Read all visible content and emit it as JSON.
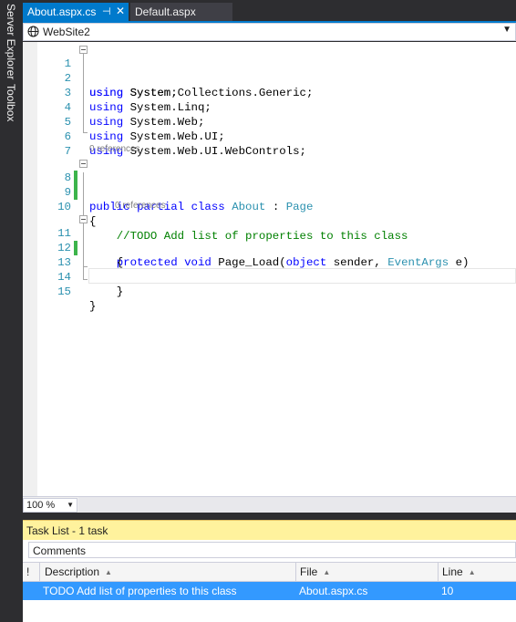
{
  "left_dock": {
    "server_explorer": "Server Explorer",
    "toolbox": "Toolbox"
  },
  "tabs": [
    {
      "label": "About.aspx.cs",
      "active": true,
      "pinned": false
    },
    {
      "label": "Default.aspx",
      "active": false
    }
  ],
  "navbar": {
    "project": "WebSite2"
  },
  "editor": {
    "lines": [
      {
        "number": "1",
        "text": "using System;"
      },
      {
        "number": "2",
        "text": "using System.Collections.Generic;"
      },
      {
        "number": "3",
        "text": "using System.Linq;"
      },
      {
        "number": "4",
        "text": "using System.Web;"
      },
      {
        "number": "5",
        "text": "using System.Web.UI;"
      },
      {
        "number": "6",
        "text": "using System.Web.UI.WebControls;"
      },
      {
        "number": "7",
        "text": ""
      },
      {
        "number": "8",
        "text": "public partial class About : Page"
      },
      {
        "number": "9",
        "text": "{"
      },
      {
        "number": "10",
        "text": "    //TODO Add list of properties to this class"
      },
      {
        "number": "11",
        "text": "    protected void Page_Load(object sender, EventArgs e)"
      },
      {
        "number": "12",
        "text": "    {"
      },
      {
        "number": "13",
        "text": ""
      },
      {
        "number": "14",
        "text": "    }"
      },
      {
        "number": "15",
        "text": "}"
      }
    ],
    "references": {
      "class_about": "0 references",
      "page_load": "0 references"
    },
    "tokens": {
      "l1": [
        "using",
        "System;"
      ],
      "l2": [
        "using",
        "System.Collections.Generic;"
      ],
      "l3": [
        "using",
        "System.Linq;"
      ],
      "l4": [
        "using",
        "System.Web;"
      ],
      "l5": [
        "using",
        "System.Web.UI;"
      ],
      "l6": [
        "using",
        "System.Web.UI.WebControls;"
      ],
      "l8": [
        "public",
        "partial",
        "class",
        "About",
        ":",
        "Page"
      ],
      "l9": "{",
      "l10": "//TODO Add list of properties to this class",
      "l11": [
        "protected",
        "void",
        "Page_Load(",
        "object",
        "sender,",
        "EventArgs",
        "e)"
      ],
      "l12": "{",
      "l14": "}",
      "l15": "}"
    }
  },
  "zoom": {
    "value": "100 %"
  },
  "task_list": {
    "title": "Task List - 1 task",
    "filter": "Comments",
    "columns": {
      "priority": "!",
      "description": "Description",
      "file": "File",
      "line": "Line"
    },
    "rows": [
      {
        "description": "TODO Add list of properties to this class",
        "file": "About.aspx.cs",
        "line": "10",
        "selected": true
      }
    ]
  },
  "colors": {
    "accent": "#007acc",
    "keyword": "#0000ff",
    "type": "#2b91af",
    "comment": "#008000",
    "change_marker": "#3cb44b",
    "selection": "#3399ff",
    "task_header": "#fff29d"
  }
}
